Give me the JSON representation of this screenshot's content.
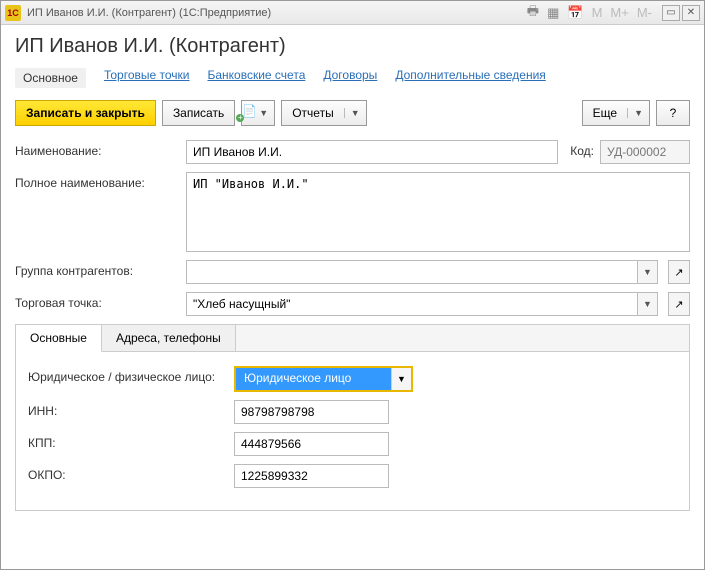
{
  "window": {
    "title": "ИП Иванов И.И. (Контрагент)  (1С:Предприятие)",
    "logo": "1C"
  },
  "header": "ИП Иванов И.И. (Контрагент)",
  "nav": {
    "main": "Основное",
    "outlets": "Торговые точки",
    "accounts": "Банковские счета",
    "contracts": "Договоры",
    "extra": "Дополнительные сведения"
  },
  "toolbar": {
    "save_close": "Записать и закрыть",
    "save": "Записать",
    "reports": "Отчеты",
    "more": "Еще",
    "help": "?"
  },
  "form": {
    "name_label": "Наименование:",
    "name_value": "ИП Иванов И.И.",
    "code_label": "Код:",
    "code_value": "УД-000002",
    "fullname_label": "Полное наименование:",
    "fullname_value": "ИП \"Иванов И.И.\"",
    "group_label": "Группа контрагентов:",
    "group_value": "",
    "outlet_label": "Торговая точка:",
    "outlet_value": "\"Хлеб насущный\""
  },
  "tabs": {
    "main": "Основные",
    "addresses": "Адреса, телефоны"
  },
  "detail": {
    "person_type_label": "Юридическое / физическое лицо:",
    "person_type_value": "Юридическое лицо",
    "inn_label": "ИНН:",
    "inn_value": "98798798798",
    "kpp_label": "КПП:",
    "kpp_value": "444879566",
    "okpo_label": "ОКПО:",
    "okpo_value": "1225899332"
  }
}
